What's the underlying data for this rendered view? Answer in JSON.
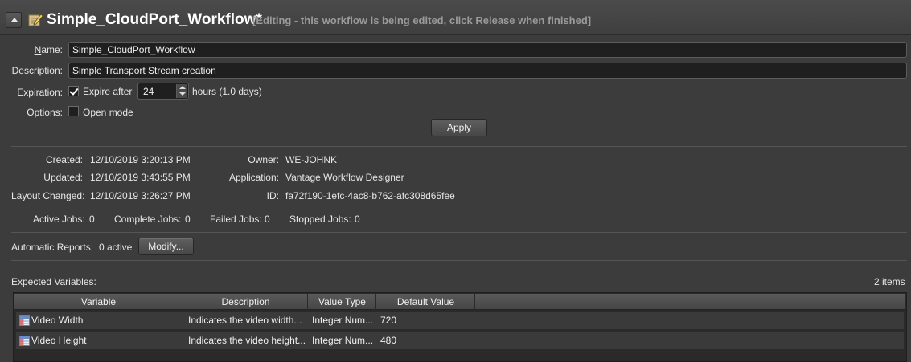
{
  "header": {
    "title": "Simple_CloudPort_Workflow*",
    "status": "[Editing - this workflow is being edited, click Release when finished]"
  },
  "form": {
    "name_label": "Name:",
    "name_value": "Simple_CloudPort_Workflow",
    "description_label": "Description:",
    "description_value": "Simple Transport Stream creation",
    "expiration_label": "Expiration:",
    "expire_after_label": "Expire after",
    "expire_after_checked": true,
    "expire_hours_value": "24",
    "hours_label": "hours (1.0 days)",
    "options_label": "Options:",
    "open_mode_label": "Open mode",
    "open_mode_checked": false,
    "apply_label": "Apply"
  },
  "info": {
    "created_label": "Created:",
    "created_value": "12/10/2019 3:20:13 PM",
    "updated_label": "Updated:",
    "updated_value": "12/10/2019 3:43:55 PM",
    "layout_changed_label": "Layout Changed:",
    "layout_changed_value": "12/10/2019 3:26:27 PM",
    "owner_label": "Owner:",
    "owner_value": "WE-JOHNK",
    "application_label": "Application:",
    "application_value": "Vantage Workflow Designer",
    "id_label": "ID:",
    "id_value": "fa72f190-1efc-4ac8-b762-afc308d65fee"
  },
  "jobs": {
    "active_label": "Active Jobs:",
    "active_value": "0",
    "complete_label": "Complete Jobs:",
    "complete_value": "0",
    "failed_label": "Failed Jobs:",
    "failed_value": "0",
    "stopped_label": "Stopped Jobs:",
    "stopped_value": "0"
  },
  "reports": {
    "label": "Automatic Reports:",
    "value": "0 active",
    "modify_label": "Modify..."
  },
  "variables": {
    "title": "Expected Variables:",
    "count": "2 items",
    "columns": [
      "Variable",
      "Description",
      "Value Type",
      "Default Value"
    ],
    "rows": [
      {
        "variable": "Video Width",
        "description": "Indicates the video width...",
        "value_type": "Integer Num...",
        "default_value": "720"
      },
      {
        "variable": "Video Height",
        "description": "Indicates the video height...",
        "value_type": "Integer Num...",
        "default_value": "480"
      }
    ]
  },
  "colors": {
    "panel_bg": "#3c3c3c",
    "field_bg": "#1f1f1f",
    "status_text": "#9a9a9a"
  }
}
